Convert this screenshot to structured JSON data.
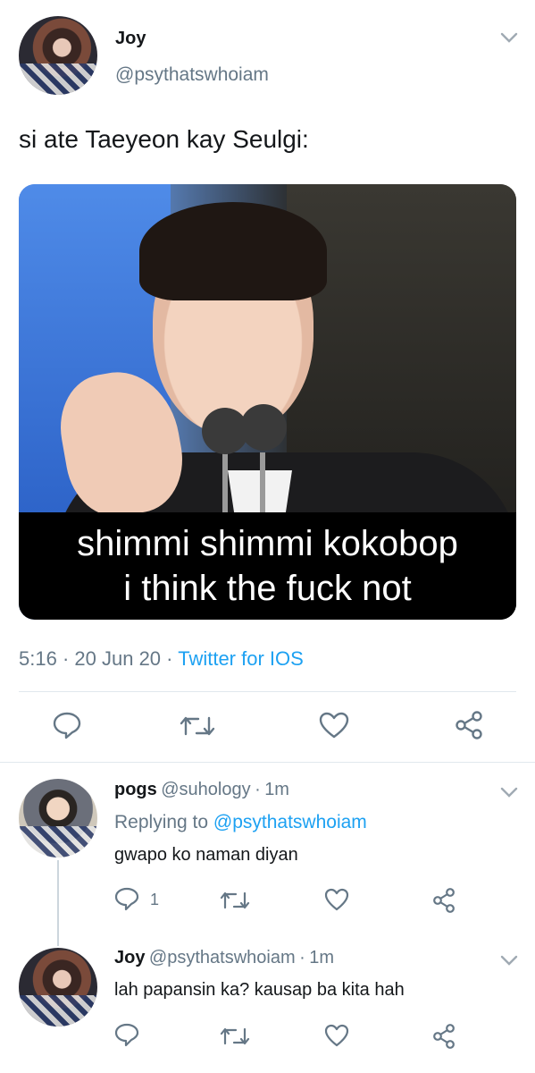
{
  "tweet": {
    "author_name": "Joy",
    "author_handle": "@psythatswhoiam",
    "text": "si ate Taeyeon kay Seulgi:",
    "image_caption_line1": "shimmi shimmi kokobop",
    "image_caption_line2": "i think the fuck not",
    "time": "5:16",
    "date": "20 Jun 20",
    "source": "Twitter for IOS",
    "sep": "·"
  },
  "replies": [
    {
      "name": "pogs",
      "handle": "@suhology",
      "age": "1m",
      "replying_to_prefix": "Replying to",
      "replying_to": "@psythatswhoiam",
      "text": "gwapo ko naman diyan",
      "reply_count": "1"
    },
    {
      "name": "Joy",
      "handle": "@psythatswhoiam",
      "age": "1m",
      "text": "lah papansin ka? kausap ba kita hah"
    }
  ],
  "icons": {
    "reply": "reply-icon",
    "retweet": "retweet-icon",
    "like": "heart-icon",
    "share": "share-icon",
    "more": "chevron-down-icon"
  },
  "colors": {
    "accent": "#1da1f2",
    "secondary_text": "#657786",
    "divider": "#e1e8ed"
  }
}
